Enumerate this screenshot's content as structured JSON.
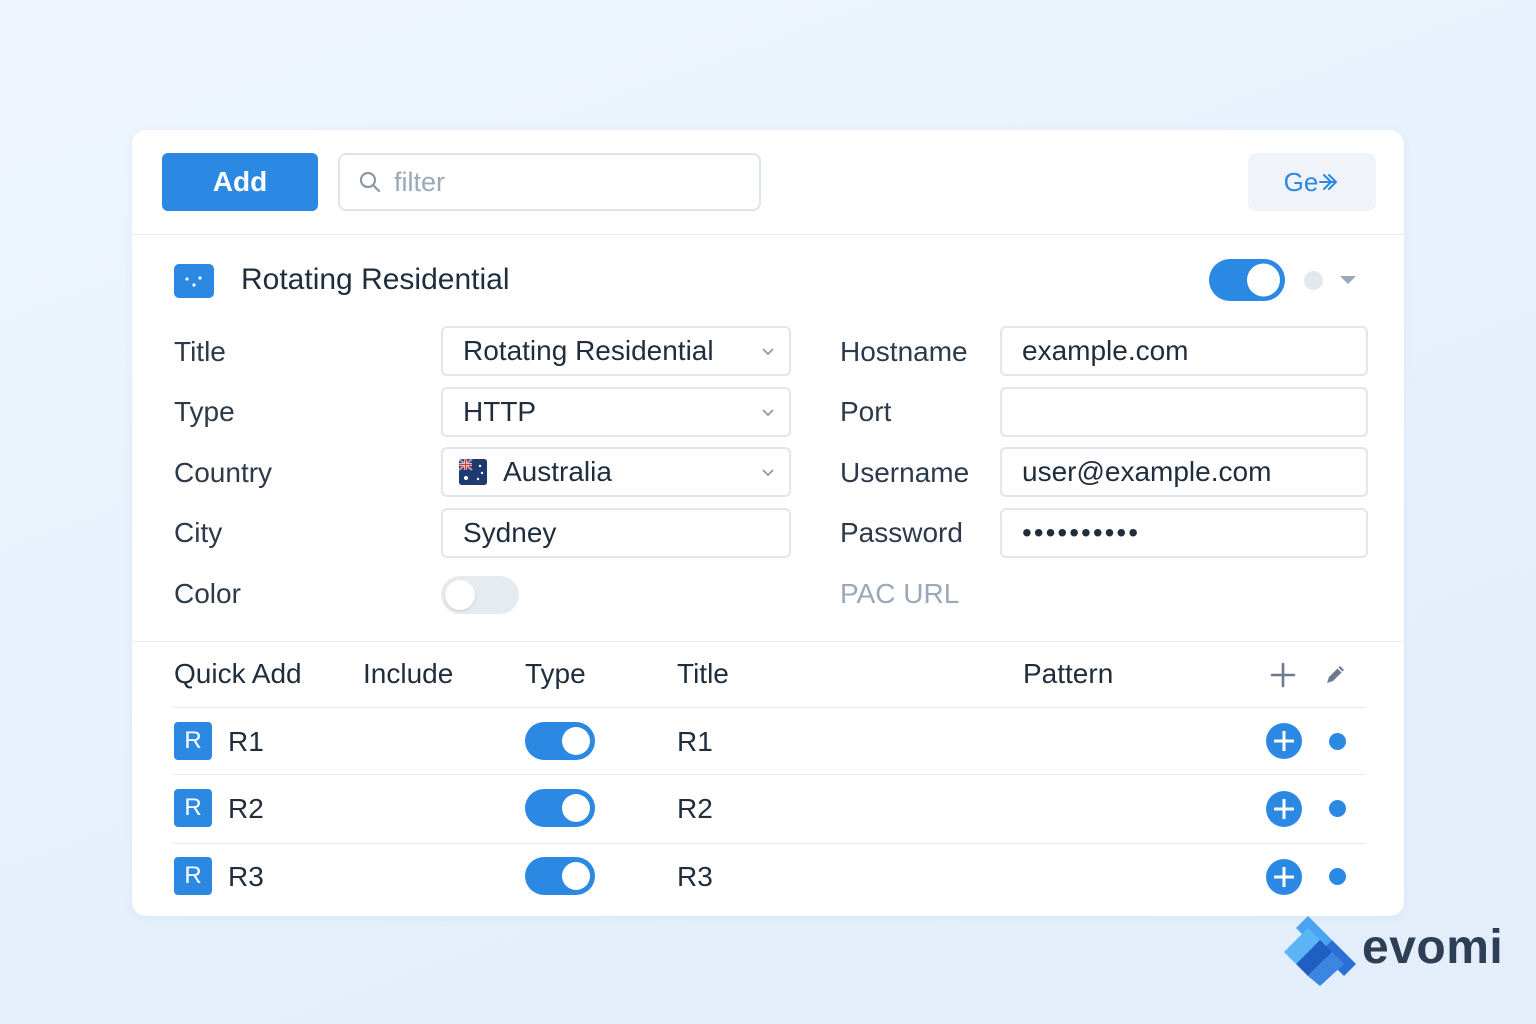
{
  "toolbar": {
    "add_label": "Add",
    "filter_placeholder": "filter",
    "go_label": "Ge"
  },
  "profile": {
    "title": "Rotating Residential",
    "enabled": true
  },
  "form": {
    "left": [
      {
        "label": "Title",
        "value": "Rotating Residential",
        "kind": "select"
      },
      {
        "label": "Type",
        "value": "HTTP",
        "kind": "select"
      },
      {
        "label": "Country",
        "value": "Australia",
        "kind": "select",
        "flag": "australia-flag"
      },
      {
        "label": "City",
        "value": "Sydney",
        "kind": "text"
      },
      {
        "label": "Color",
        "kind": "toggle",
        "on": false
      }
    ],
    "right": [
      {
        "label": "Hostname",
        "value": "example.com"
      },
      {
        "label": "Port",
        "value": ""
      },
      {
        "label": "Username",
        "value": "user@example.com"
      },
      {
        "label": "Password",
        "value": "••••••••••"
      },
      {
        "label": "PAC URL"
      }
    ]
  },
  "table": {
    "headers": [
      "Quick Add",
      "Include",
      "Type",
      "Title",
      "Pattern"
    ],
    "rows": [
      {
        "badge": "R",
        "name": "R1",
        "type_on": true,
        "title": "R1"
      },
      {
        "badge": "R",
        "name": "R2",
        "type_on": true,
        "title": "R2"
      },
      {
        "badge": "R",
        "name": "R3",
        "type_on": true,
        "title": "R3"
      }
    ]
  },
  "brand": {
    "name": "evomi"
  },
  "colors": {
    "accent": "#2b88e3",
    "text": "#1f2d3d",
    "muted": "#9aa8b8",
    "border": "#e1e6ec"
  }
}
